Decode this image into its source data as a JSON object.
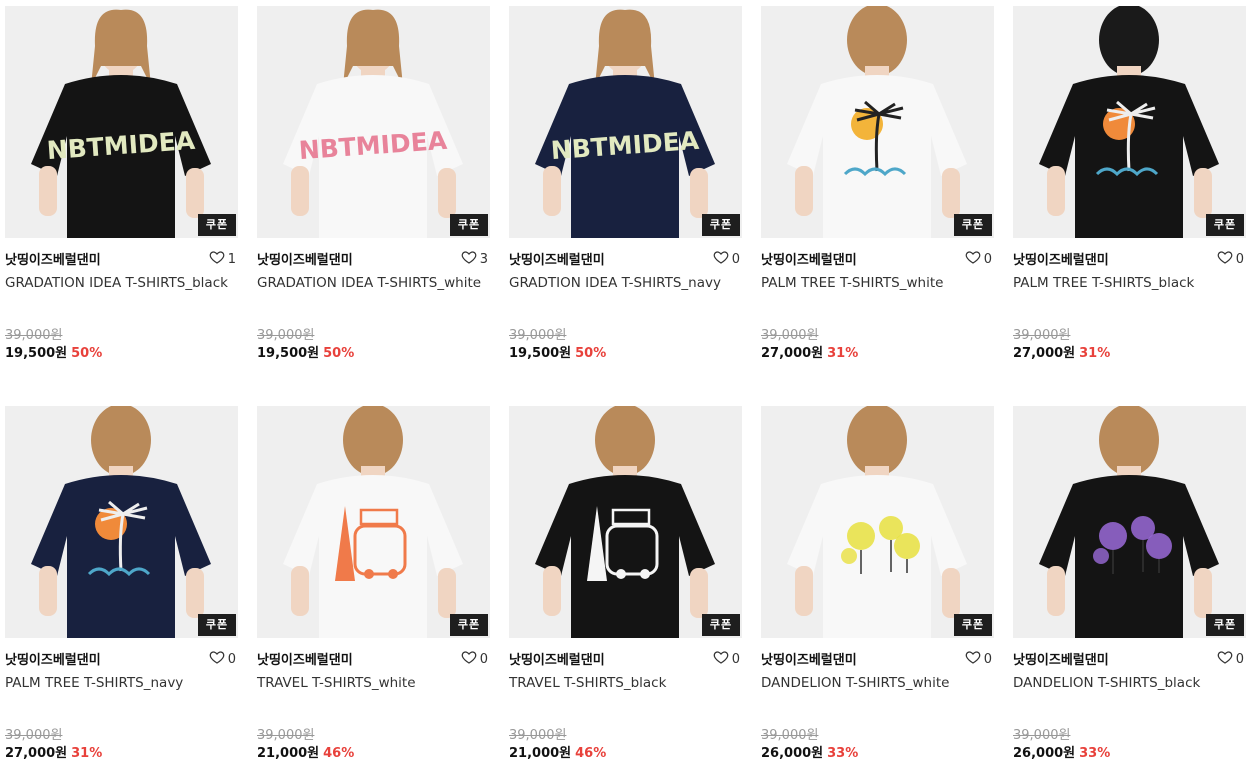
{
  "coupon_label": "쿠폰",
  "colors": {
    "discount": "#e8413b",
    "coupon_bg": "#1e1e1e"
  },
  "products": [
    {
      "brand": "낫띵이즈베럴댄미",
      "name": "GRADATION IDEA T-SHIRTS_black",
      "likes": "1",
      "original_price": "39,000원",
      "price": "19,500원",
      "discount": "50%",
      "shirt": "#141414",
      "print": "NBTMIDEA",
      "print_color": "#e2e9c0"
    },
    {
      "brand": "낫띵이즈베럴댄미",
      "name": "GRADATION IDEA T-SHIRTS_white",
      "likes": "3",
      "original_price": "39,000원",
      "price": "19,500원",
      "discount": "50%",
      "shirt": "#f8f8f8",
      "print": "NBTMIDEA",
      "print_color": "#e8839a"
    },
    {
      "brand": "낫띵이즈베럴댄미",
      "name": "GRADTION IDEA T-SHIRTS_navy",
      "likes": "0",
      "original_price": "39,000원",
      "price": "19,500원",
      "discount": "50%",
      "shirt": "#18213f",
      "print": "NBTMIDEA",
      "print_color": "#e2e9c0"
    },
    {
      "brand": "낫띵이즈베럴댄미",
      "name": "PALM TREE T-SHIRTS_white",
      "likes": "0",
      "original_price": "39,000원",
      "price": "27,000원",
      "discount": "31%",
      "shirt": "#f8f8f8",
      "print": "",
      "print_color": "#f3b43a"
    },
    {
      "brand": "낫띵이즈베럴댄미",
      "name": "PALM TREE T-SHIRTS_black",
      "likes": "0",
      "original_price": "39,000원",
      "price": "27,000원",
      "discount": "31%",
      "shirt": "#141414",
      "print": "",
      "print_color": "#f08a3a"
    },
    {
      "brand": "낫띵이즈베럴댄미",
      "name": "PALM TREE T-SHIRTS_navy",
      "likes": "0",
      "original_price": "39,000원",
      "price": "27,000원",
      "discount": "31%",
      "shirt": "#18213f",
      "print": "",
      "print_color": "#f08a3a"
    },
    {
      "brand": "낫띵이즈베럴댄미",
      "name": "TRAVEL T-SHIRTS_white",
      "likes": "0",
      "original_price": "39,000원",
      "price": "21,000원",
      "discount": "46%",
      "shirt": "#f8f8f8",
      "print": "",
      "print_color": "#f07a4a"
    },
    {
      "brand": "낫띵이즈베럴댄미",
      "name": "TRAVEL T-SHIRTS_black",
      "likes": "0",
      "original_price": "39,000원",
      "price": "21,000원",
      "discount": "46%",
      "shirt": "#141414",
      "print": "",
      "print_color": "#f5f5f5"
    },
    {
      "brand": "낫띵이즈베럴댄미",
      "name": "DANDELION T-SHIRTS_white",
      "likes": "0",
      "original_price": "39,000원",
      "price": "26,000원",
      "discount": "33%",
      "shirt": "#f8f8f8",
      "print": "",
      "print_color": "#e8e040"
    },
    {
      "brand": "낫띵이즈베럴댄미",
      "name": "DANDELION T-SHIRTS_black",
      "likes": "0",
      "original_price": "39,000원",
      "price": "26,000원",
      "discount": "33%",
      "shirt": "#141414",
      "print": "",
      "print_color": "#9a6ad8"
    }
  ]
}
